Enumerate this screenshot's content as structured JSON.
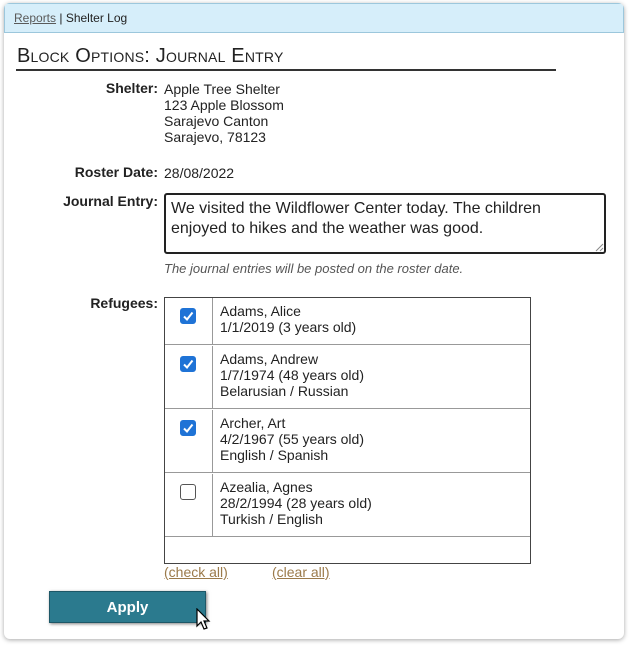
{
  "breadcrumb": {
    "link": "Reports",
    "separator": " | ",
    "current": "Shelter Log"
  },
  "page_title": "Block Options: Journal Entry",
  "shelter": {
    "label": "Shelter:",
    "lines": [
      "Apple Tree Shelter",
      "123 Apple Blossom",
      "Sarajevo Canton",
      "Sarajevo, 78123"
    ]
  },
  "roster": {
    "label": "Roster Date:",
    "value": "28/08/2022"
  },
  "journal": {
    "label": "Journal Entry:",
    "value": "We visited the Wildflower Center today. The children enjoyed to hikes and the weather was good.",
    "hint": "The journal entries will be posted on the roster date."
  },
  "refugees": {
    "label": "Refugees:",
    "rows": [
      {
        "checked": true,
        "name": "Adams, Alice",
        "dob": "1/1/2019 (3 years old)",
        "languages": ""
      },
      {
        "checked": true,
        "name": "Adams, Andrew",
        "dob": "1/7/1974 (48 years old)",
        "languages": "Belarusian / Russian"
      },
      {
        "checked": true,
        "name": "Archer, Art",
        "dob": "4/2/1967 (55 years old)",
        "languages": "English / Spanish"
      },
      {
        "checked": false,
        "name": "Azealia, Agnes",
        "dob": "28/2/1994 (28 years old)",
        "languages": "Turkish / English"
      }
    ],
    "check_all": "(check all)",
    "clear_all": "(clear all)"
  },
  "apply_label": "Apply",
  "colors": {
    "accent_button": "#2b7a8e",
    "checkbox_checked": "#1f73d6",
    "header_bar": "#d6eefa"
  }
}
